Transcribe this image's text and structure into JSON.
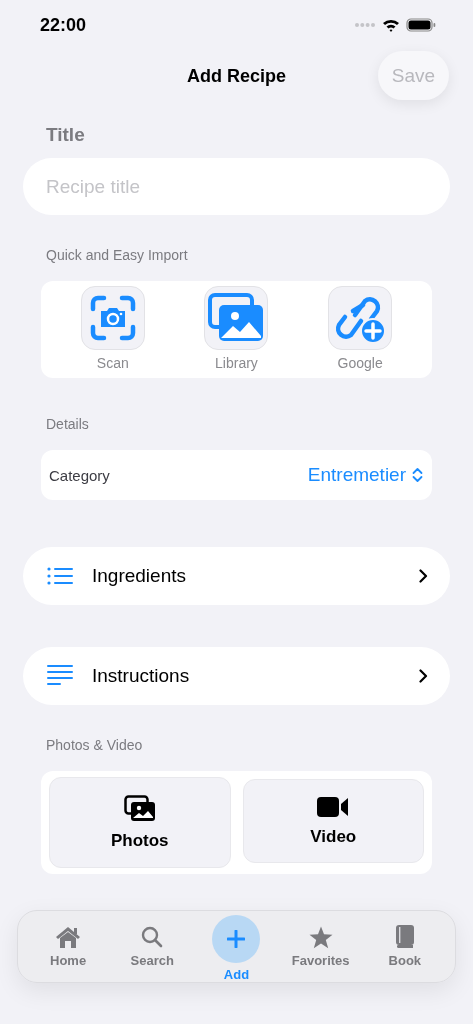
{
  "status_bar": {
    "time": "22:00"
  },
  "nav": {
    "title": "Add Recipe",
    "save_button": {
      "label": "Save",
      "disabled": true
    }
  },
  "title_section": {
    "label": "Title",
    "field": {
      "placeholder": "Recipe title"
    }
  },
  "import_section": {
    "header": "Quick and Easy Import",
    "items": [
      {
        "kind": "scan",
        "label": "Scan"
      },
      {
        "kind": "library",
        "label": "Library"
      },
      {
        "kind": "link",
        "label": "Google"
      }
    ]
  },
  "details": {
    "header": "Details",
    "rows": [
      {
        "label": "Category",
        "value": "Entremetier"
      }
    ]
  },
  "nav_rows": [
    {
      "kind": "ingredients",
      "label": "Ingredients"
    },
    {
      "kind": "instructions",
      "label": "Instructions"
    }
  ],
  "media": {
    "header": "Photos & Video",
    "buttons": [
      {
        "kind": "photos",
        "label": "Photos"
      },
      {
        "kind": "video",
        "label": "Video"
      }
    ]
  },
  "tab_bar": [
    {
      "kind": "home",
      "label": "Home",
      "selected": false
    },
    {
      "kind": "search",
      "label": "Search",
      "selected": false
    },
    {
      "kind": "add",
      "label": "Add",
      "selected": true
    },
    {
      "kind": "favorites",
      "label": "Favorites",
      "selected": false
    },
    {
      "kind": "book",
      "label": "Book",
      "selected": false
    }
  ]
}
